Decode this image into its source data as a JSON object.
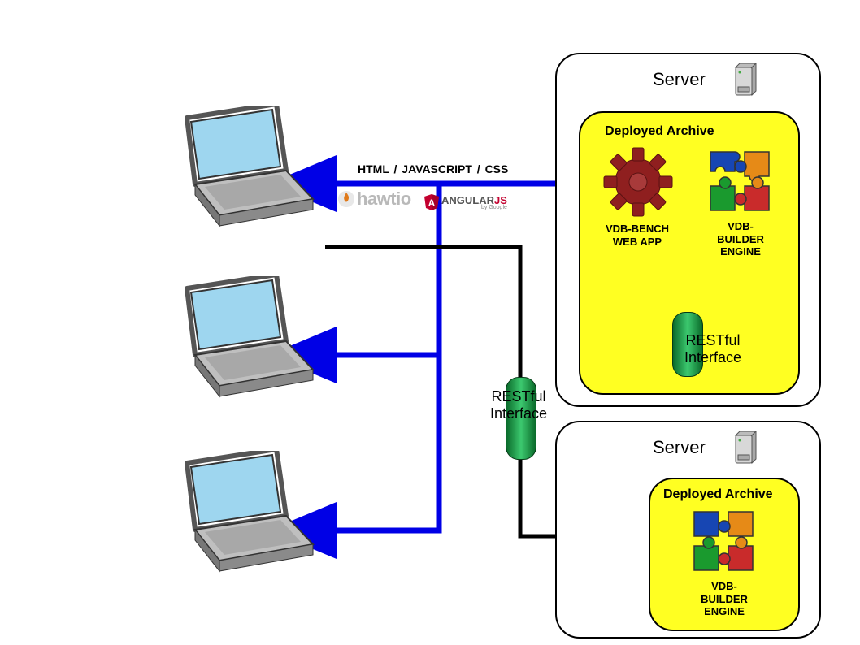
{
  "labels": {
    "server": "Server",
    "deployed_archive": "Deployed Archive",
    "vdb_bench_l1": "VDB-BENCH",
    "vdb_bench_l2": "WEB APP",
    "vdb_builder_l1": "VDB-",
    "vdb_builder_l2": "BUILDER",
    "vdb_builder_l3": "ENGINE",
    "restful_l1": "RESTful",
    "restful_l2": "Interface",
    "tech_stack": "HTML  / JAVASCRIPT / CSS",
    "brand_hawtio": "hawtio",
    "brand_angular_a": "ANGULAR",
    "brand_angular_b": "JS",
    "brand_angular_sub": "by Google"
  },
  "colors": {
    "blue_arrow": "#0000e6",
    "black_arrow": "#000000",
    "archive_bg": "#ffff22",
    "gear": "#8f1f1f",
    "angular_red": "#c3002f"
  }
}
